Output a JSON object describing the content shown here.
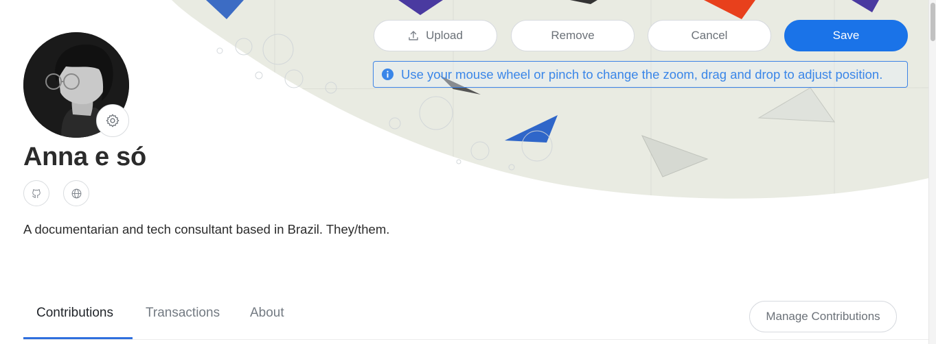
{
  "cover": {
    "upload_label": "Upload",
    "remove_label": "Remove",
    "cancel_label": "Cancel",
    "save_label": "Save",
    "hint_text": "Use your mouse wheel or pinch to change the zoom, drag and drop to adjust position."
  },
  "profile": {
    "name": "Anna e só",
    "bio": "A documentarian and tech consultant based in Brazil. They/them."
  },
  "social": [
    "github-icon",
    "globe-icon"
  ],
  "tabs": [
    {
      "label": "Contributions",
      "active": true
    },
    {
      "label": "Transactions",
      "active": false
    },
    {
      "label": "About",
      "active": false
    }
  ],
  "actions": {
    "manage_label": "Manage Contributions"
  },
  "colors": {
    "accent": "#1a73e8",
    "hint": "#3a86e8",
    "tab_underline": "#2f6fde"
  }
}
